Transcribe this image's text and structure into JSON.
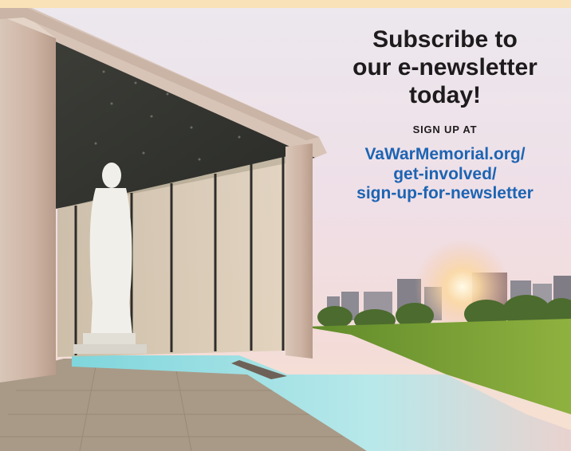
{
  "promo": {
    "headline_lines": [
      "Subscribe to",
      "our e-newsletter",
      "today!"
    ],
    "signup_label": "SIGN UP AT",
    "url_lines": [
      "VaWarMemorial.org/",
      "get-involved/",
      "sign-up-for-newsletter"
    ]
  },
  "colors": {
    "top_band": "#f9e2b7",
    "headline_text": "#1d1b1c",
    "link_text": "#1d64b3"
  }
}
